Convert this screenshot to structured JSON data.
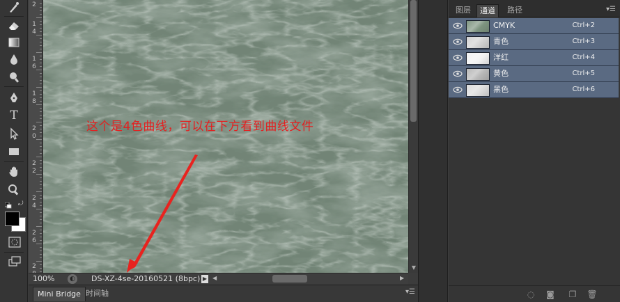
{
  "tools": [
    {
      "name": "history-brush-icon",
      "glyph": "✎"
    },
    {
      "name": "eraser-icon",
      "glyph": "⌫"
    },
    {
      "name": "gradient-icon",
      "glyph": "■"
    },
    {
      "name": "blur-icon",
      "glyph": "💧"
    },
    {
      "name": "dodge-icon",
      "glyph": "●"
    },
    {
      "name": "pen-icon",
      "glyph": "✒"
    },
    {
      "name": "type-icon",
      "glyph": "T"
    },
    {
      "name": "path-select-icon",
      "glyph": "➤"
    },
    {
      "name": "rectangle-icon",
      "glyph": "▭"
    },
    {
      "name": "hand-icon",
      "glyph": "✋"
    },
    {
      "name": "zoom-icon",
      "glyph": "🔍"
    }
  ],
  "ruler": {
    "labels": [
      [
        "2"
      ],
      [
        "1",
        "4"
      ],
      [
        "1",
        "6"
      ],
      [
        "1",
        "8"
      ],
      [
        "2",
        "0"
      ],
      [
        "2",
        "2"
      ],
      [
        "2",
        "4"
      ],
      [
        "2",
        "6"
      ],
      [
        "2",
        "8"
      ]
    ]
  },
  "canvas": {
    "annotation": "这个是4色曲线，可以在下方看到曲线文件",
    "annotation_color": "#e32020",
    "marble_color": "#7d8f80"
  },
  "status": {
    "zoom": "100%",
    "doc_info": "DS-XZ-4se-20160521 (8bpc)"
  },
  "bottom_tabs": {
    "mini_bridge": "Mini Bridge",
    "timeline": "时间轴"
  },
  "panel": {
    "tabs": {
      "layers": "图层",
      "channels": "通道",
      "paths": "路径"
    },
    "channels": [
      {
        "name": "CMYK",
        "shortcut": "Ctrl+2",
        "thumb": "#7e9480"
      },
      {
        "name": "青色",
        "shortcut": "Ctrl+3",
        "thumb": "#d2d2d2"
      },
      {
        "name": "洋红",
        "shortcut": "Ctrl+4",
        "thumb": "#f2f2f2"
      },
      {
        "name": "黄色",
        "shortcut": "Ctrl+5",
        "thumb": "#b8b8b8"
      },
      {
        "name": "黑色",
        "shortcut": "Ctrl+6",
        "thumb": "#dcdcdc"
      }
    ],
    "footer_icons": [
      "load-selection-icon",
      "save-selection-icon",
      "new-channel-icon",
      "delete-icon"
    ]
  },
  "colors": {
    "selection_row": "#5a6a82",
    "ui_dark": "#353535"
  }
}
